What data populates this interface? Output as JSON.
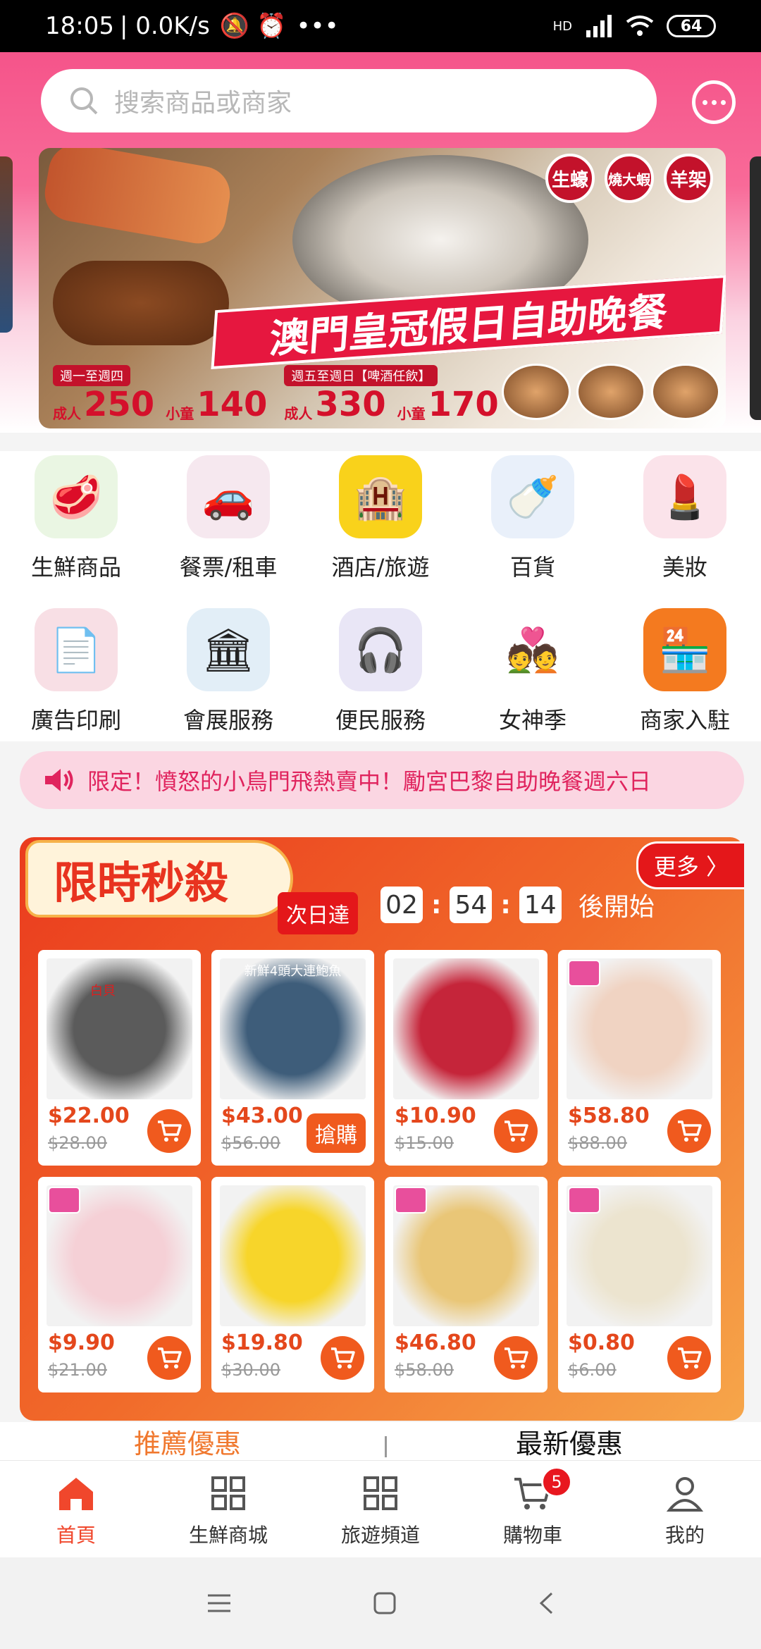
{
  "status_bar": {
    "time": "18:05",
    "speed": "| 0.0K/s",
    "dots": "•••",
    "network": "HD",
    "battery": "64"
  },
  "search": {
    "placeholder": "搜索商品或商家"
  },
  "banner": {
    "badges": [
      "生蠔",
      "燒大蝦",
      "羊架"
    ],
    "headline": "澳門皇冠假日自助晚餐",
    "weekday_tag": "週一至週四",
    "weekend_tag": "週五至週日【啤酒任飲】",
    "prices": [
      {
        "label": "成人",
        "value": "250"
      },
      {
        "label": "小童",
        "value": "140"
      },
      {
        "label": "成人",
        "value": "330"
      },
      {
        "label": "小童",
        "value": "170"
      }
    ]
  },
  "categories": [
    {
      "label": "生鮮商品",
      "icon": "fresh-produce-icon",
      "color": "#eaf6e3"
    },
    {
      "label": "餐票/租車",
      "icon": "meal-car-icon",
      "color": "#f6e8ef"
    },
    {
      "label": "酒店/旅遊",
      "icon": "hotel-icon",
      "color": "#f9d21b"
    },
    {
      "label": "百貨",
      "icon": "department-store-icon",
      "color": "#e9f0fa"
    },
    {
      "label": "美妝",
      "icon": "cosmetics-icon",
      "color": "#fbe3ea"
    },
    {
      "label": "廣告印刷",
      "icon": "printing-icon",
      "color": "#f8dfe5"
    },
    {
      "label": "會展服務",
      "icon": "exhibition-icon",
      "color": "#e2eef7"
    },
    {
      "label": "便民服務",
      "icon": "customer-service-icon",
      "color": "#e9e6f6"
    },
    {
      "label": "女神季",
      "icon": "goddess-season-icon",
      "color": "#ffffff"
    },
    {
      "label": "商家入駐",
      "icon": "merchant-join-icon",
      "color": "#f47a1f"
    }
  ],
  "notice": {
    "text": "限定！憤怒的小鳥門飛熱賣中！勵宮巴黎自助晚餐週六日"
  },
  "flash_sale": {
    "title": "限時秒殺",
    "next_day": "次日達",
    "countdown": [
      "02",
      "54",
      "14"
    ],
    "suffix": "後開始",
    "more": "更多 〉",
    "products": [
      {
        "price": "$22.00",
        "orig": "$28.00",
        "img": "#5b5b5b",
        "button": "cart"
      },
      {
        "price": "$43.00",
        "orig": "$56.00",
        "img": "#3e5d7a",
        "button": "grab"
      },
      {
        "price": "$10.90",
        "orig": "$15.00",
        "img": "#c5253a",
        "button": "cart"
      },
      {
        "price": "$58.80",
        "orig": "$88.00",
        "img": "#f0d3c2",
        "button": "cart"
      },
      {
        "price": "$9.90",
        "orig": "$21.00",
        "img": "#f5d0d6",
        "button": "cart"
      },
      {
        "price": "$19.80",
        "orig": "$30.00",
        "img": "#f7d52a",
        "button": "cart"
      },
      {
        "price": "$46.80",
        "orig": "$58.00",
        "img": "#e9c677",
        "button": "cart"
      },
      {
        "price": "$0.80",
        "orig": "$6.00",
        "img": "#ece4cf",
        "button": "cart"
      }
    ],
    "grab_label": "搶購",
    "product2_caption": "新鮮4頭大連鮑魚",
    "product1_note": "白貝"
  },
  "tabs": {
    "recommended": "推薦優惠",
    "latest": "最新優惠"
  },
  "bottom_nav": [
    {
      "label": "首頁",
      "icon": "home-icon",
      "active": true
    },
    {
      "label": "生鮮商城",
      "icon": "grid-icon",
      "active": false
    },
    {
      "label": "旅遊頻道",
      "icon": "grid-icon",
      "active": false
    },
    {
      "label": "購物車",
      "icon": "cart-icon",
      "active": false,
      "badge": "5"
    },
    {
      "label": "我的",
      "icon": "profile-icon",
      "active": false
    }
  ],
  "colors": {
    "brand_pink": "#f5548a",
    "accent_orange": "#f05a1e",
    "price_red": "#e4471c"
  }
}
